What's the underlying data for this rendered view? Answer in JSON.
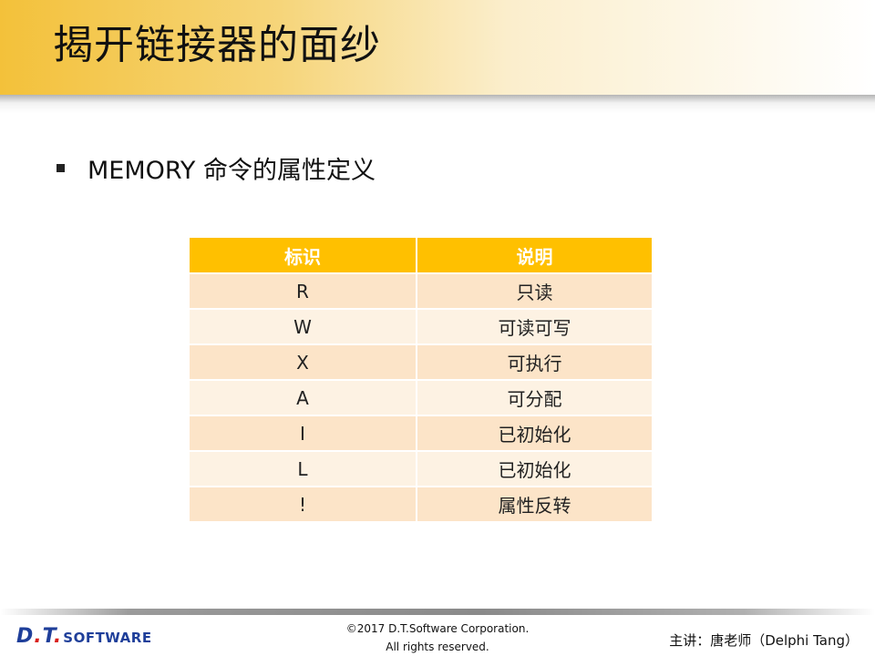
{
  "header": {
    "title": "揭开链接器的面纱"
  },
  "bullet": {
    "text": "MEMORY 命令的属性定义"
  },
  "table": {
    "headers": [
      "标识",
      "说明"
    ],
    "rows": [
      [
        "R",
        "只读"
      ],
      [
        "W",
        "可读可写"
      ],
      [
        "X",
        "可执行"
      ],
      [
        "A",
        "可分配"
      ],
      [
        "I",
        "已初始化"
      ],
      [
        "L",
        "已初始化"
      ],
      [
        "!",
        "属性反转"
      ]
    ],
    "colors": {
      "header": "#ffc000",
      "row_odd": "#fce4c8",
      "row_even": "#fdf2e3"
    }
  },
  "footer": {
    "logo": {
      "prefix_d": "D",
      "dot1": ".",
      "prefix_t": "T",
      "dot2": ".",
      "rest": "SOFTWARE"
    },
    "copyright_line1": "©2017 D.T.Software Corporation.",
    "copyright_line2": "All rights reserved.",
    "speaker": "主讲：唐老师（Delphi Tang）"
  }
}
